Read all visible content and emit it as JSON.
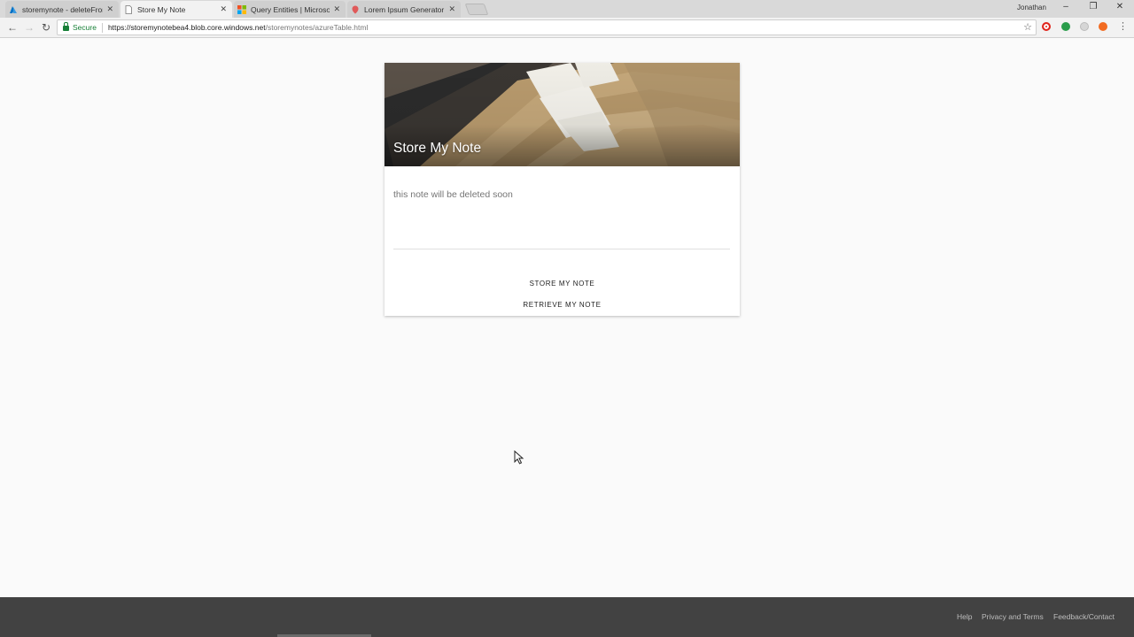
{
  "browser": {
    "tabs": [
      {
        "label": "storemynote - deleteFron",
        "favicon": "azure-icon",
        "active": false
      },
      {
        "label": "Store My Note",
        "favicon": "page-icon",
        "active": true
      },
      {
        "label": "Query Entities | Microsoft",
        "favicon": "microsoft-icon",
        "active": false
      },
      {
        "label": "Lorem Ipsum Generator",
        "favicon": "lorem-icon",
        "active": false
      }
    ],
    "user": "Jonathan",
    "secure_label": "Secure",
    "url_host": "https://storemynotebea4.blob.core.windows.net",
    "url_path": "/storemynotes/azureTable.html",
    "close_glyph": "✕"
  },
  "card": {
    "title": "Store My Note",
    "note_text": "this note will be deleted soon",
    "store_label": "STORE MY NOTE",
    "retrieve_label": "RETRIEVE MY NOTE"
  },
  "footer": {
    "links": [
      "Help",
      "Privacy and Terms",
      "Feedback/Contact"
    ]
  },
  "colors": {
    "page_bg": "#fafafa",
    "footer_bg": "#424242",
    "secure_green": "#188038"
  }
}
